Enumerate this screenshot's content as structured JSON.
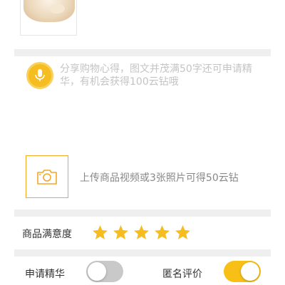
{
  "review": {
    "placeholder": "分享购物心得，图文并茂满50字还可申请精华，有机会获得100云钻哦"
  },
  "upload": {
    "hint": "上传商品视频或3张照片可得50云钻"
  },
  "rating": {
    "label": "商品满意度",
    "stars": 5,
    "max_stars": 5,
    "star_color": "#f5bd20"
  },
  "options": {
    "apply_featured_label": "申请精华",
    "apply_featured_on": false,
    "anonymous_label": "匿名评价",
    "anonymous_on": true
  },
  "colors": {
    "accent": "#f5bd20",
    "toggle_on": "#f8bf16",
    "toggle_off": "#c9c9c9",
    "divider": "#efefef"
  },
  "icons": {
    "voice": "microphone-icon",
    "upload": "camera-icon",
    "rating": "star-icon"
  }
}
